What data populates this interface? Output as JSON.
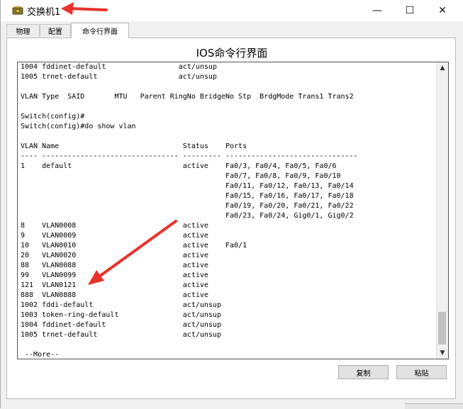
{
  "window": {
    "title": "交换机1",
    "icon": "switch-device-icon",
    "controls": {
      "minimize": "—",
      "maximize": "☐",
      "close": "✕"
    }
  },
  "tabs": [
    {
      "label": "物理",
      "active": false
    },
    {
      "label": "配置",
      "active": false
    },
    {
      "label": "命令行界面",
      "active": true
    }
  ],
  "panel": {
    "title": "IOS命令行界面"
  },
  "terminal": {
    "lines": [
      "1004 fddinet-default                 act/unsup",
      "1005 trnet-default                   act/unsup",
      "",
      "VLAN Type  SAID       MTU   Parent RingNo BridgeNo Stp  BrdgMode Trans1 Trans2",
      "",
      "Switch(config)#",
      "Switch(config)#do show vlan",
      "",
      "VLAN Name                             Status    Ports",
      "---- -------------------------------- --------- -------------------------------",
      "1    default                          active    Fa0/3, Fa0/4, Fa0/5, Fa0/6",
      "                                                Fa0/7, Fa0/8, Fa0/9, Fa0/10",
      "                                                Fa0/11, Fa0/12, Fa0/13, Fa0/14",
      "                                                Fa0/15, Fa0/16, Fa0/17, Fa0/18",
      "                                                Fa0/19, Fa0/20, Fa0/21, Fa0/22",
      "                                                Fa0/23, Fa0/24, Gig0/1, Gig0/2",
      "8    VLAN0008                         active",
      "9    VLAN0009                         active",
      "10   VLAN0010                         active    Fa0/1",
      "20   VLAN0020                         active",
      "88   VLAN0088                         active",
      "99   VLAN0099                         active",
      "121  VLAN0121                         active",
      "888  VLAN0888                         active",
      "1002 fddi-default                     act/unsup",
      "1003 token-ring-default               act/unsup",
      "1004 fddinet-default                  act/unsup",
      "1005 trnet-default                    act/unsup",
      "",
      " --More--"
    ]
  },
  "buttons": {
    "copy": "复制",
    "paste": "粘贴"
  },
  "colors": {
    "annotation_arrow": "#e8332a",
    "terminal_border": "#555555"
  }
}
